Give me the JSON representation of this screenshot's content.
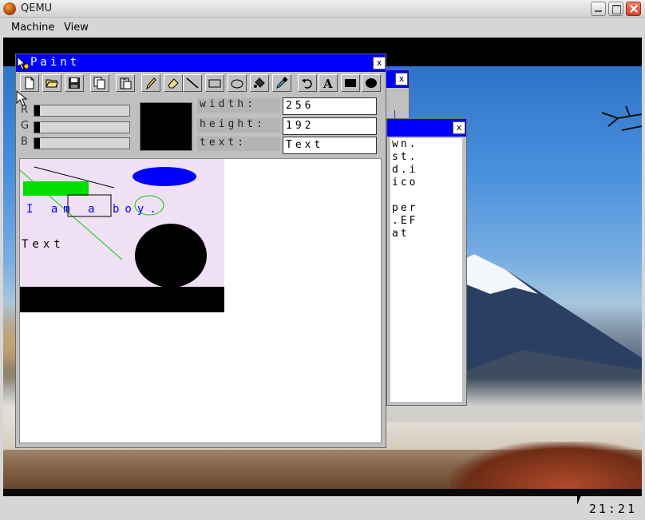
{
  "host": {
    "title": "QEMU",
    "menu": [
      "Machine",
      "View"
    ],
    "controls": {
      "minimize": "minimize-icon",
      "maximize": "maximize-icon",
      "close": "close-icon"
    }
  },
  "guest": {
    "clock": "21:21",
    "paint": {
      "title": "Paint",
      "close": "x",
      "tools": [
        "new-file-icon",
        "open-folder-icon",
        "save-icon",
        "copy-icon",
        "paste-icon",
        "pencil-icon",
        "eraser-icon",
        "line-icon",
        "rectangle-icon",
        "ellipse-icon",
        "fill-bucket-icon",
        "color-picker-icon",
        "undo-icon",
        "text-icon",
        "filled-rectangle-icon",
        "filled-ellipse-icon"
      ],
      "rgb": {
        "r_label": "R",
        "g_label": "G",
        "b_label": "B",
        "r_value": 0,
        "g_value": 0,
        "b_value": 0
      },
      "current_color": "#000000",
      "props": {
        "width_label": "width:",
        "width_value": "256",
        "height_label": "height:",
        "height_value": "192",
        "text_label": "text:",
        "text_value": "Text"
      },
      "drawing": {
        "background": "#efe0f3",
        "text_blue": "I am a boy.",
        "text_black": "Text",
        "colors": {
          "blue": "#0000ff",
          "green": "#00dd00",
          "black": "#000000"
        }
      }
    },
    "window2": {
      "close": "x"
    },
    "window3": {
      "close": "x",
      "lines": [
        "wn.",
        "st.",
        "d.i",
        "ico",
        "",
        "per",
        ".EF",
        "at"
      ]
    }
  }
}
